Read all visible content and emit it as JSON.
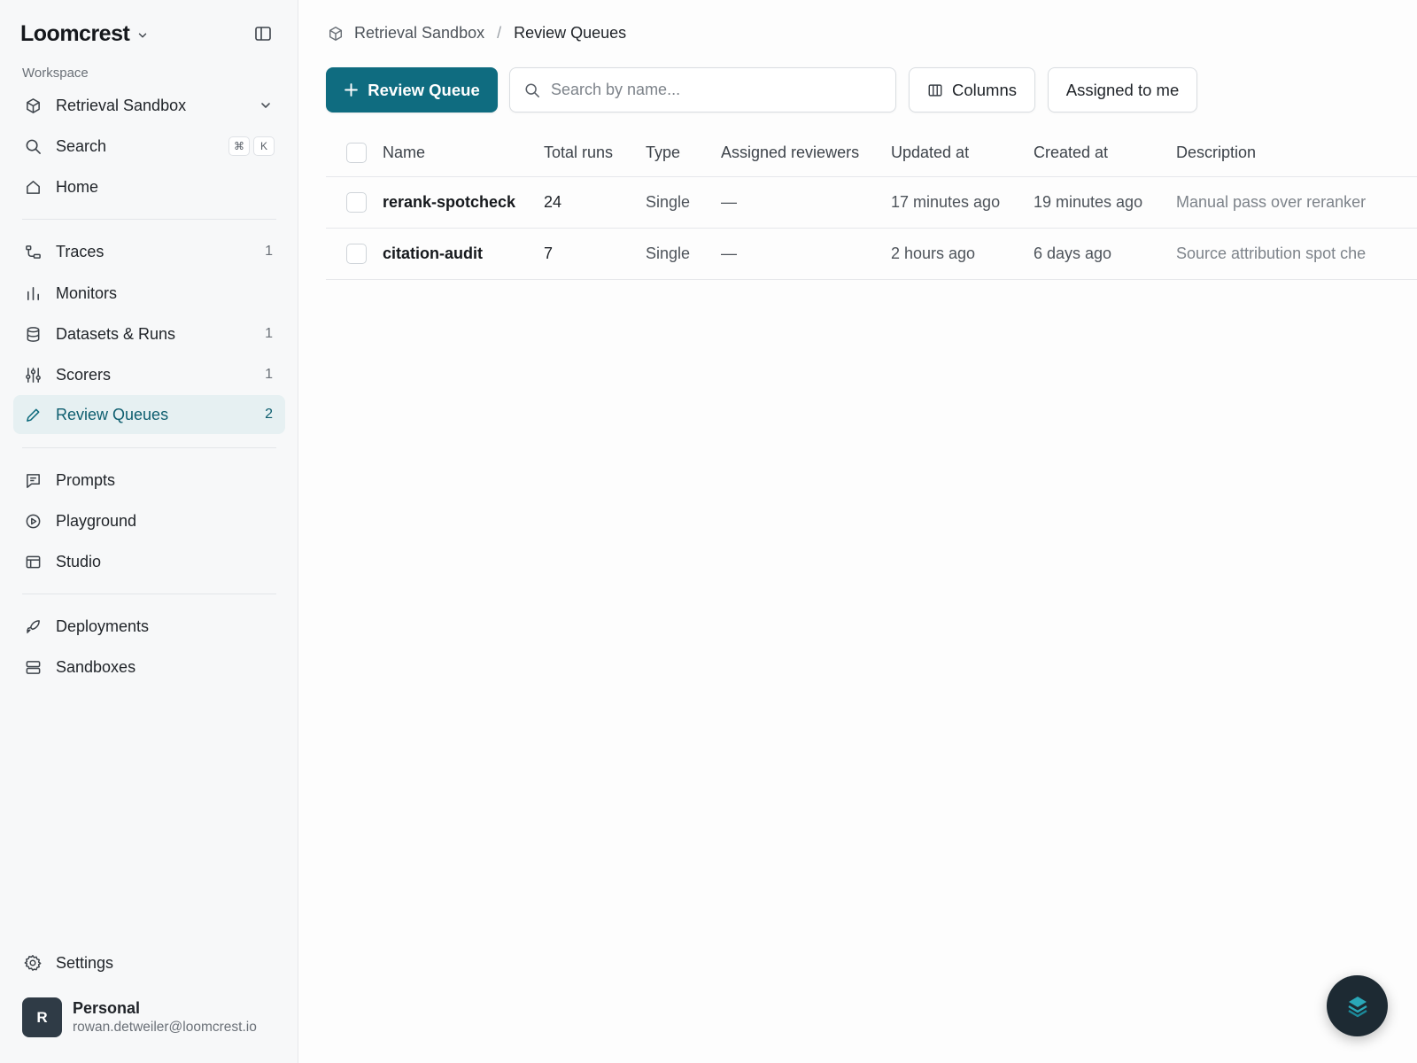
{
  "app": {
    "brand": "Loomcrest"
  },
  "sidebar": {
    "workspace_label": "Workspace",
    "project": "Retrieval Sandbox",
    "search_label": "Search",
    "shortcut_keys": [
      "⌘",
      "K"
    ],
    "home_label": "Home",
    "items": [
      {
        "label": "Traces",
        "count": "1"
      },
      {
        "label": "Monitors",
        "count": ""
      },
      {
        "label": "Datasets & Runs",
        "count": "1"
      },
      {
        "label": "Scorers",
        "count": "1"
      },
      {
        "label": "Review Queues",
        "count": "2",
        "active": true
      },
      {
        "label": "Prompts",
        "count": ""
      },
      {
        "label": "Playground",
        "count": ""
      },
      {
        "label": "Studio",
        "count": ""
      },
      {
        "label": "Deployments",
        "count": ""
      },
      {
        "label": "Sandboxes",
        "count": ""
      }
    ],
    "settings_label": "Settings",
    "user": {
      "initial": "R",
      "name": "Personal",
      "email": "rowan.detweiler@loomcrest.io"
    }
  },
  "breadcrumb": {
    "parent": "Retrieval Sandbox",
    "separator": "/",
    "current": "Review Queues"
  },
  "toolbar": {
    "new_label": "Review Queue",
    "search_placeholder": "Search by name...",
    "columns_label": "Columns",
    "assigned_label": "Assigned to me"
  },
  "table": {
    "columns": [
      "Name",
      "Total runs",
      "Type",
      "Assigned reviewers",
      "Updated at",
      "Created at",
      "Description"
    ],
    "rows": [
      {
        "name": "rerank-spotcheck",
        "total_runs": "24",
        "type": "Single",
        "reviewers": "—",
        "updated": "17 minutes ago",
        "created": "19 minutes ago",
        "description": "Manual pass over reranker"
      },
      {
        "name": "citation-audit",
        "total_runs": "7",
        "type": "Single",
        "reviewers": "—",
        "updated": "2 hours ago",
        "created": "6 days ago",
        "description": "Source attribution spot che"
      }
    ]
  },
  "colors": {
    "accent": "#0f6c80",
    "active_bg": "#e6f0f2",
    "sidebar_bg": "#f7f8f9",
    "fab_bg": "#1d2a33"
  }
}
